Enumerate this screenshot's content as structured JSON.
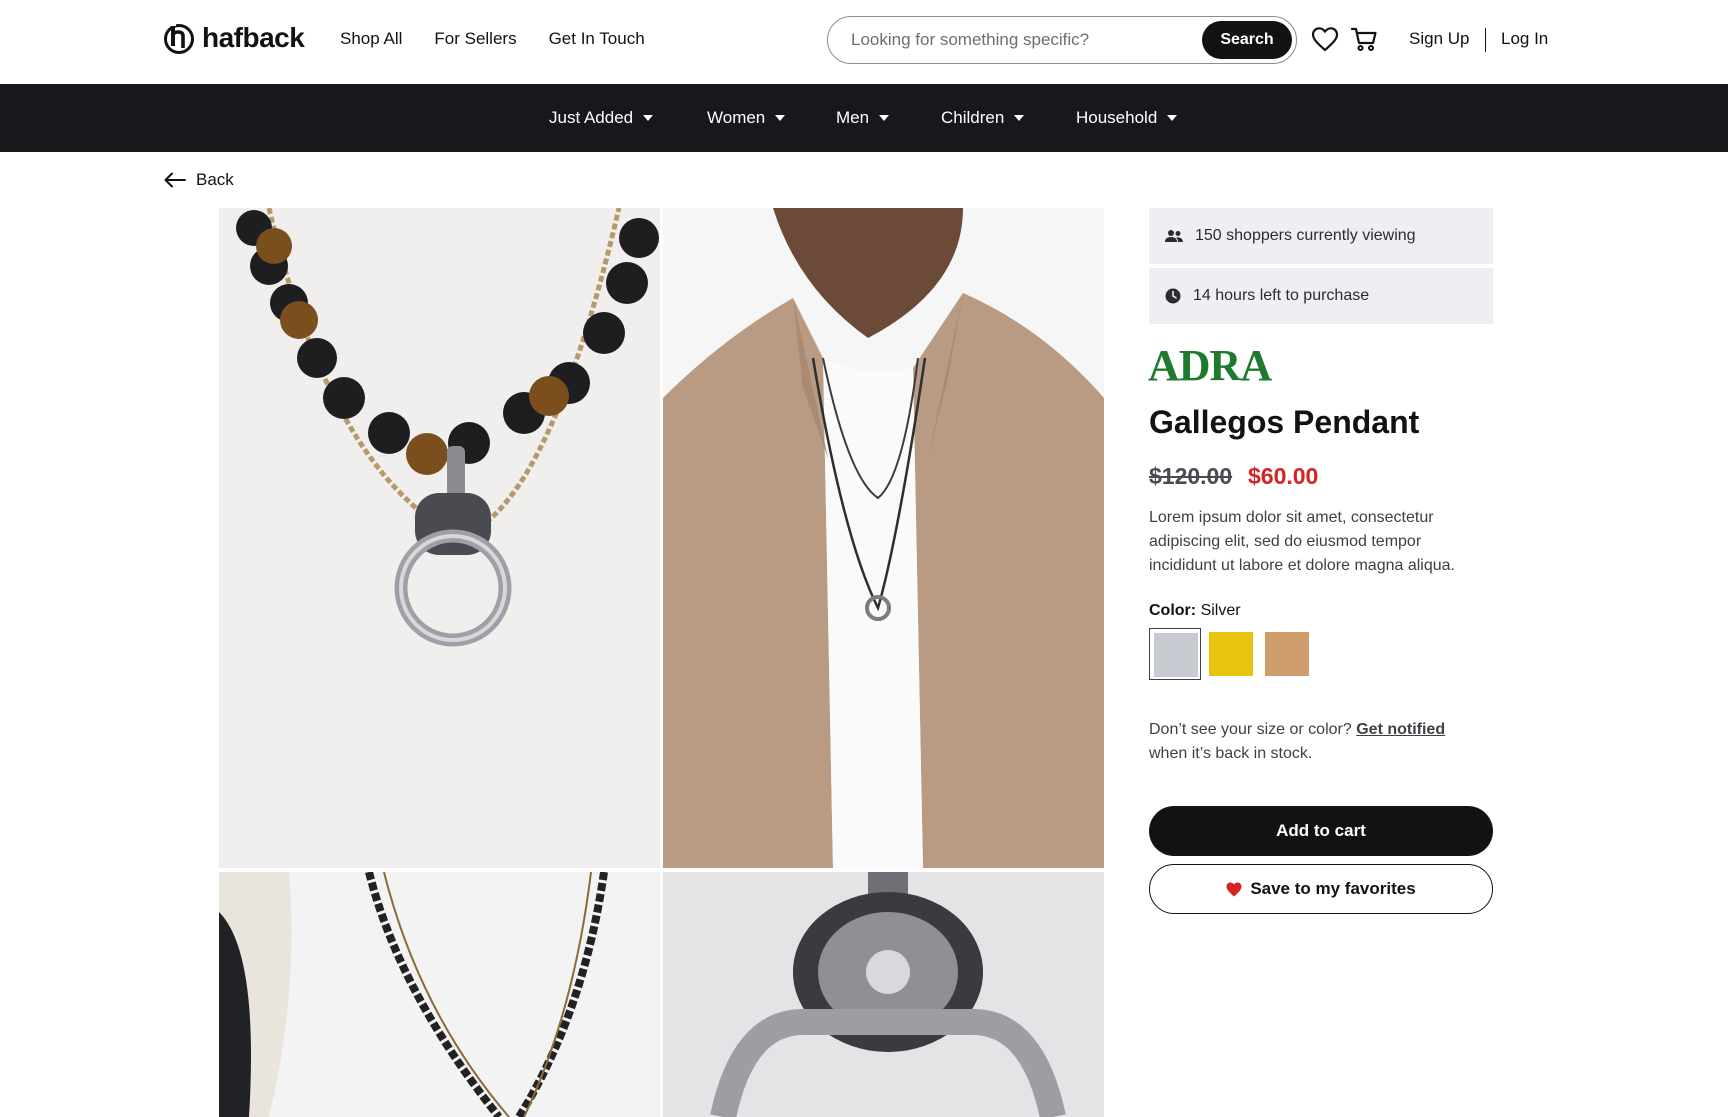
{
  "header": {
    "logo_text": "hafback",
    "nav": [
      {
        "label": "Shop All"
      },
      {
        "label": "For Sellers"
      },
      {
        "label": "Get In Touch"
      }
    ],
    "search": {
      "placeholder": "Looking for something specific?",
      "button_label": "Search"
    },
    "icons": {
      "favorites": "heart-icon",
      "cart": "cart-icon"
    },
    "sign_up_label": "Sign Up",
    "log_in_label": "Log In"
  },
  "categories": [
    {
      "label": "Just Added"
    },
    {
      "label": "Women"
    },
    {
      "label": "Men"
    },
    {
      "label": "Children"
    },
    {
      "label": "Household"
    }
  ],
  "back_label": "Back",
  "gallery": {
    "images": [
      {
        "name": "necklace-closeup-photo"
      },
      {
        "name": "model-wearing-necklace-photo"
      },
      {
        "name": "layered-necklaces-photo"
      },
      {
        "name": "pendant-detail-photo"
      }
    ]
  },
  "product": {
    "viewers_text": "150 shoppers currently viewing",
    "time_left_text": "14 hours left to purchase",
    "brand": "ADRA",
    "brand_color": "#1f7a2e",
    "title": "Gallegos Pendant",
    "original_price": "$120.00",
    "sale_price": "$60.00",
    "sale_price_color": "#d42323",
    "description": "Lorem ipsum dolor sit amet, consectetur adipiscing elit, sed do eiusmod tempor incididunt ut labore et dolore magna aliqua.",
    "color_label": "Color:",
    "selected_color": "Silver",
    "swatches": [
      {
        "name": "Silver",
        "hex": "#c8cbd1"
      },
      {
        "name": "Gold",
        "hex": "#e8c40e"
      },
      {
        "name": "Tan",
        "hex": "#cf9c6c"
      }
    ],
    "notify_text_before": "Don’t see your size or color?",
    "notify_link": "Get notified",
    "notify_text_after": "when it’s back in stock.",
    "add_to_cart_label": "Add to cart",
    "save_label": "Save to my favorites"
  }
}
